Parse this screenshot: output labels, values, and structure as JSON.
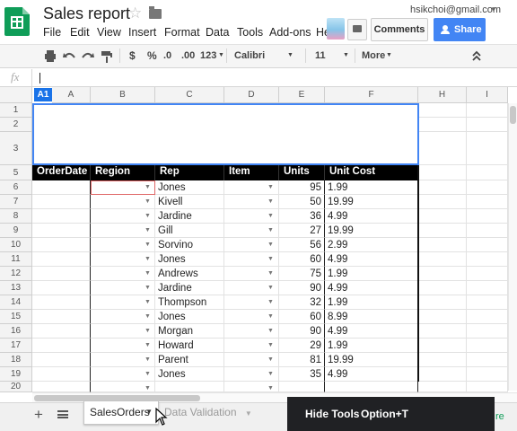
{
  "app": {
    "title": "Sales report",
    "user_email": "hsikchoi@gmail.com",
    "email_caret": "▼",
    "star": "☆"
  },
  "menu": [
    "File",
    "Edit",
    "View",
    "Insert",
    "Format",
    "Data",
    "Tools",
    "Add-ons",
    "Help"
  ],
  "buttons": {
    "comments": "Comments",
    "share": "Share"
  },
  "toolbar": {
    "currency": "$",
    "percent": "%",
    "decrease_decimals": ".0",
    "increase_decimals": ".00",
    "number_format": "123",
    "font": "Calibri",
    "font_size": "11",
    "more": "More",
    "caret": "▼",
    "collapse": "⌃"
  },
  "formula_bar": {
    "fx": "fx",
    "value": ""
  },
  "name_box": "A1",
  "columns": [
    "A",
    "B",
    "C",
    "D",
    "E",
    "F",
    "H",
    "I"
  ],
  "rows": [
    "1",
    "2",
    "3",
    "5",
    "6",
    "7",
    "8",
    "9",
    "10",
    "11",
    "12",
    "13",
    "14",
    "15",
    "16",
    "17",
    "18",
    "19",
    "20"
  ],
  "table": {
    "headers": [
      "OrderDate",
      "Region",
      "Rep",
      "Item",
      "Units",
      "Unit Cost"
    ],
    "data": [
      [
        "",
        "",
        "Jones",
        "",
        "95",
        "1.99"
      ],
      [
        "",
        "",
        "Kivell",
        "",
        "50",
        "19.99"
      ],
      [
        "",
        "",
        "Jardine",
        "",
        "36",
        "4.99"
      ],
      [
        "",
        "",
        "Gill",
        "",
        "27",
        "19.99"
      ],
      [
        "",
        "",
        "Sorvino",
        "",
        "56",
        "2.99"
      ],
      [
        "",
        "",
        "Jones",
        "",
        "60",
        "4.99"
      ],
      [
        "",
        "",
        "Andrews",
        "",
        "75",
        "1.99"
      ],
      [
        "",
        "",
        "Jardine",
        "",
        "90",
        "4.99"
      ],
      [
        "",
        "",
        "Thompson",
        "",
        "32",
        "1.99"
      ],
      [
        "",
        "",
        "Jones",
        "",
        "60",
        "8.99"
      ],
      [
        "",
        "",
        "Morgan",
        "",
        "90",
        "4.99"
      ],
      [
        "",
        "",
        "Howard",
        "",
        "29",
        "1.99"
      ],
      [
        "",
        "",
        "Parent",
        "",
        "81",
        "19.99"
      ],
      [
        "",
        "",
        "Jones",
        "",
        "35",
        "4.99"
      ],
      [
        "",
        "",
        "",
        "",
        "",
        ""
      ]
    ]
  },
  "sheets": {
    "add": "+",
    "tabs": [
      {
        "label": "SalesOrders",
        "active": true
      },
      {
        "label": "Data Validation",
        "active": false
      }
    ]
  },
  "tooltip": {
    "label": "Hide Tools",
    "shortcut": "Option+T"
  },
  "explore_partial": "re",
  "colors": {
    "sheets_green": "#0f9d58",
    "share_blue": "#4285f4",
    "selection_blue": "#4285f4",
    "header_black": "#000000"
  }
}
